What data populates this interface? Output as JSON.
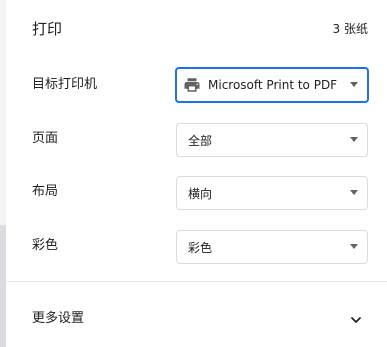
{
  "header": {
    "title": "打印",
    "sheet_count": "3 张纸"
  },
  "settings": {
    "destination": {
      "label": "目标打印机",
      "value": "Microsoft Print to PDF",
      "icon": "printer-icon"
    },
    "pages": {
      "label": "页面",
      "value": "全部"
    },
    "layout": {
      "label": "布局",
      "value": "横向"
    },
    "color": {
      "label": "彩色",
      "value": "彩色"
    }
  },
  "more_settings": {
    "label": "更多设置",
    "icon": "chevron-down-icon"
  },
  "colors": {
    "accent": "#1a73e8",
    "text": "#202124",
    "border": "#dadce0",
    "icon": "#5f6368"
  }
}
